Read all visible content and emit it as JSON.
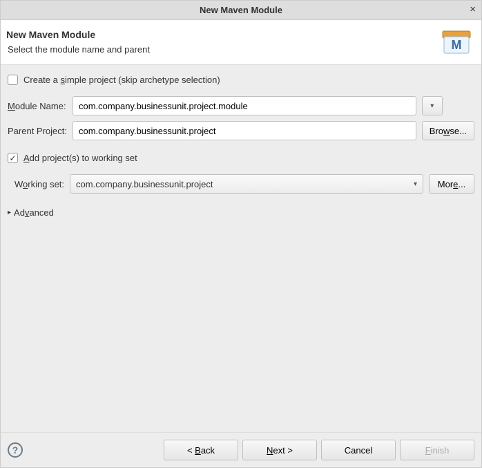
{
  "titlebar": {
    "title": "New Maven Module",
    "close": "×"
  },
  "header": {
    "title": "New Maven Module",
    "subtitle": "Select the module name and parent"
  },
  "simpleProject": {
    "checked": false,
    "label_pre": "Create a ",
    "label_mn": "s",
    "label_post": "imple project (skip archetype selection)"
  },
  "moduleName": {
    "label_mn": "M",
    "label_post": "odule Name:",
    "value": "com.company.businessunit.project.module"
  },
  "parentProject": {
    "label": "Parent Project:",
    "value": "com.company.businessunit.project",
    "browse_pre": "Bro",
    "browse_mn": "w",
    "browse_post": "se..."
  },
  "addToWorkingSet": {
    "checked": true,
    "label_mn": "A",
    "label_post": "dd project(s) to working set"
  },
  "workingSet": {
    "label_pre": "W",
    "label_mn": "o",
    "label_post": "rking set:",
    "value": "com.company.businessunit.project",
    "more_pre": "Mor",
    "more_mn": "e",
    "more_post": "..."
  },
  "advanced": {
    "label_pre": "Ad",
    "label_mn": "v",
    "label_post": "anced"
  },
  "buttons": {
    "back_pre": "< ",
    "back_mn": "B",
    "back_post": "ack",
    "next_mn": "N",
    "next_post": "ext >",
    "cancel": "Cancel",
    "finish_mn": "F",
    "finish_post": "inish"
  }
}
